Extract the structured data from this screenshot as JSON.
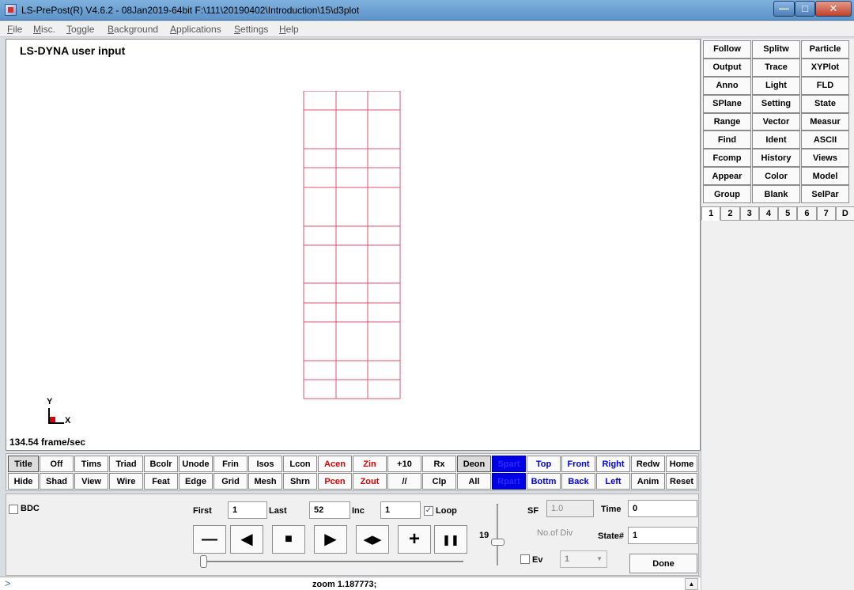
{
  "window": {
    "title": "LS-PrePost(R) V4.6.2 - 08Jan2019-64bit F:\\111\\20190402\\Introduction\\15\\d3plot"
  },
  "menu": [
    "File",
    "Misc.",
    "Toggle",
    "Background",
    "Applications",
    "Settings",
    "Help"
  ],
  "viewport": {
    "title": "LS-DYNA user input",
    "fps": "134.54 frame/sec",
    "triad_y": "Y",
    "triad_x": "X",
    "mesh_color": "#e05070"
  },
  "right_panel": {
    "buttons": [
      "Follow",
      "Splitw",
      "Particle",
      "Output",
      "Trace",
      "XYPlot",
      "Anno",
      "Light",
      "FLD",
      "SPlane",
      "Setting",
      "State",
      "Range",
      "Vector",
      "Measur",
      "Find",
      "Ident",
      "ASCII",
      "Fcomp",
      "History",
      "Views",
      "Appear",
      "Color",
      "Model",
      "Group",
      "Blank",
      "SelPar"
    ],
    "tabs": [
      "1",
      "2",
      "3",
      "4",
      "5",
      "6",
      "7",
      "D"
    ],
    "active_tab": "1"
  },
  "toolbar": {
    "row1": [
      "Title",
      "Off",
      "Tims",
      "Triad",
      "Bcolr",
      "Unode",
      "Frin",
      "Isos",
      "Lcon",
      "Acen",
      "Zin",
      "+10",
      "Rx",
      "Deon",
      "Spart",
      "Top",
      "Front",
      "Right",
      "Redw",
      "Home"
    ],
    "row2": [
      "Hide",
      "Shad",
      "View",
      "Wire",
      "Feat",
      "Edge",
      "Grid",
      "Mesh",
      "Shrn",
      "Pcen",
      "Zout",
      "//",
      "Clp",
      "All",
      "Rpart",
      "Bottm",
      "Back",
      "Left",
      "Anim",
      "Reset"
    ],
    "accent_red": "#e00000",
    "accent_blue": "#0000e6"
  },
  "animation": {
    "bdc_label": "BDC",
    "first_label": "First",
    "first_value": "1",
    "last_label": "Last",
    "last_value": "52",
    "inc_label": "Inc",
    "inc_value": "1",
    "loop_label": "Loop",
    "loop_checked": "✓",
    "speed_value": "19",
    "sf_label": "SF",
    "sf_value": "1.0",
    "nodiv_label": "No.of Div",
    "ev_label": "Ev",
    "div_value": "1",
    "time_label": "Time",
    "time_value": "0",
    "state_label": "State#",
    "state_value": "1",
    "done_label": "Done"
  },
  "cmdline": {
    "prompt": ">",
    "text": "zoom 1.187773;"
  }
}
